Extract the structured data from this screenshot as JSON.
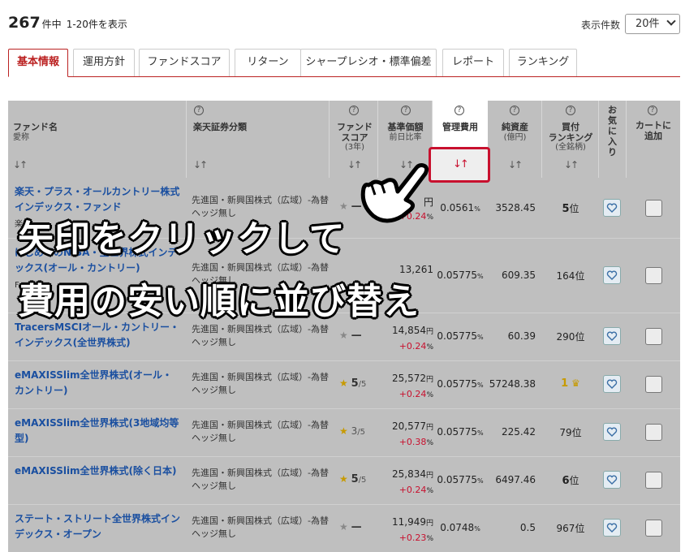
{
  "summary": {
    "total": "267",
    "total_suffix": "件中",
    "range": "1-20件を表示"
  },
  "perpage": {
    "label": "表示件数",
    "selected": "20件"
  },
  "tabs": [
    "基本情報",
    "運用方針",
    "ファンドスコア",
    "リターン",
    "シャープレシオ・標準偏差",
    "レポート",
    "ランキング"
  ],
  "columns": {
    "fund": {
      "title": "ファンド名",
      "sub": "愛称"
    },
    "category": {
      "title": "楽天証券分類"
    },
    "score": {
      "title": "ファンド",
      "title2": "スコア",
      "sub": "(3年)"
    },
    "price": {
      "title": "基準価額",
      "sub": "前日比率"
    },
    "fee": {
      "title": "管理費用"
    },
    "assets": {
      "title": "純資産",
      "sub": "(億円)"
    },
    "ranking": {
      "title": "買付",
      "title2": "ランキング",
      "sub": "(全銘柄)"
    },
    "favorite": {
      "title": "お気に入り"
    },
    "cart": {
      "title": "カートに追加"
    },
    "sort_glyph": "↓↑",
    "help_glyph": "?"
  },
  "rows": [
    {
      "name": "楽天・プラス・オールカントリー株式インデックス・ファンド",
      "sub": "楽",
      "category": "先進国・新興国株式（広域）-為替ヘッジ無し",
      "score": "—",
      "score_max": "",
      "price": "円",
      "change": "+0.24",
      "fee": "0.0561",
      "assets": "3528.45",
      "rank": "5",
      "rank_unit": "位"
    },
    {
      "name": "はじめてのNISA・全世界株式インデックス(オール・カントリー)",
      "sub": "F",
      "category": "先進国・新興国株式（広域）-為替ヘッジ無し",
      "score": "",
      "score_max": "",
      "price": "13,261",
      "change": "",
      "fee": "0.05775",
      "assets": "609.35",
      "rank": "164",
      "rank_unit": "位"
    },
    {
      "name": "TracersMSCIオール・カントリー・インデックス(全世界株式)",
      "sub": "",
      "category": "先進国・新興国株式（広域）-為替ヘッジ無し",
      "score": "—",
      "score_max": "",
      "price": "14,854",
      "change": "+0.24",
      "fee": "0.05775",
      "assets": "60.39",
      "rank": "290",
      "rank_unit": "位"
    },
    {
      "name": "eMAXISSlim全世界株式(オール・カントリー)",
      "sub": "",
      "category": "先進国・新興国株式（広域）-為替ヘッジ無し",
      "score": "5",
      "score_max": "/5",
      "price": "25,572",
      "change": "+0.24",
      "fee": "0.05775",
      "assets": "57248.38",
      "rank": "1",
      "rank_unit": ""
    },
    {
      "name": "eMAXISSlim全世界株式(3地域均等型)",
      "sub": "",
      "category": "先進国・新興国株式（広域）-為替ヘッジ無し",
      "score": "3",
      "score_max": "/5",
      "price": "20,577",
      "change": "+0.38",
      "fee": "0.05775",
      "assets": "225.42",
      "rank": "79",
      "rank_unit": "位"
    },
    {
      "name": "eMAXISSlim全世界株式(除く日本)",
      "sub": "",
      "category": "先進国・新興国株式（広域）-為替ヘッジ無し",
      "score": "5",
      "score_max": "/5",
      "price": "25,834",
      "change": "+0.24",
      "fee": "0.05775",
      "assets": "6497.46",
      "rank": "6",
      "rank_unit": "位"
    },
    {
      "name": "ステート・ストリート全世界株式インデックス・オープン",
      "sub": "",
      "category": "先進国・新興国株式（広域）-為替ヘッジ無し",
      "score": "—",
      "score_max": "",
      "price": "11,949",
      "change": "+0.23",
      "fee": "0.0748",
      "assets": "0.5",
      "rank": "967",
      "rank_unit": "位"
    }
  ],
  "units": {
    "yen": "円",
    "percent": "%"
  },
  "overlay": {
    "line1": "矢印をクリックして",
    "line2": "費用の安い順に並び替え"
  },
  "colors": {
    "accent": "#c8102e",
    "link": "#1a4fa0",
    "star": "#c79a00"
  }
}
